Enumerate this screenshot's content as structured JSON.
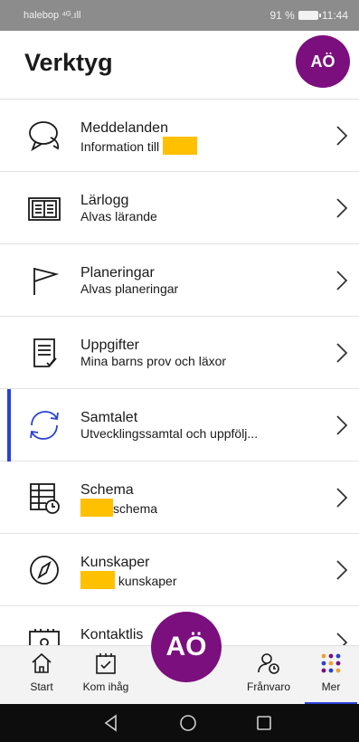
{
  "status_bar": {
    "carrier": "halebop ⁴ᴳ.ıll",
    "battery_percent": "91 %",
    "time": "11:44"
  },
  "header": {
    "title": "Verktyg",
    "avatar_initials": "AÖ"
  },
  "items": [
    {
      "title": "Meddelanden",
      "subtitle": "Information till",
      "icon": "chat-bubble-icon"
    },
    {
      "title": "Lärlogg",
      "subtitle": "Alvas lärande",
      "icon": "open-book-icon"
    },
    {
      "title": "Planeringar",
      "subtitle": "Alvas planeringar",
      "icon": "flag-icon"
    },
    {
      "title": "Uppgifter",
      "subtitle": "Mina barns prov och läxor",
      "icon": "checklist-icon"
    },
    {
      "title": "Samtalet",
      "subtitle": "Utvecklingssamtal och uppfölj...",
      "icon": "sync-arrows-icon",
      "active": true
    },
    {
      "title": "Schema",
      "subtitle": "schema",
      "icon": "calendar-clock-icon"
    },
    {
      "title": "Kunskaper",
      "subtitle": "kunskaper",
      "icon": "compass-icon"
    },
    {
      "title": "Kontaktlis",
      "subtitle": "",
      "icon": "contact-card-icon"
    }
  ],
  "bottom_nav": {
    "items": [
      {
        "label": "Start",
        "icon": "home-icon"
      },
      {
        "label": "Kom ihåg",
        "icon": "calendar-check-icon"
      },
      {
        "label": "Frånvaro",
        "icon": "person-clock-icon"
      },
      {
        "label": "Mer",
        "icon": "app-grid-icon",
        "active": true
      }
    ],
    "fab_initials": "AÖ"
  },
  "colors": {
    "accent": "#2a41d6",
    "avatar": "#7b0f7e",
    "highlight": "#ffc000"
  }
}
